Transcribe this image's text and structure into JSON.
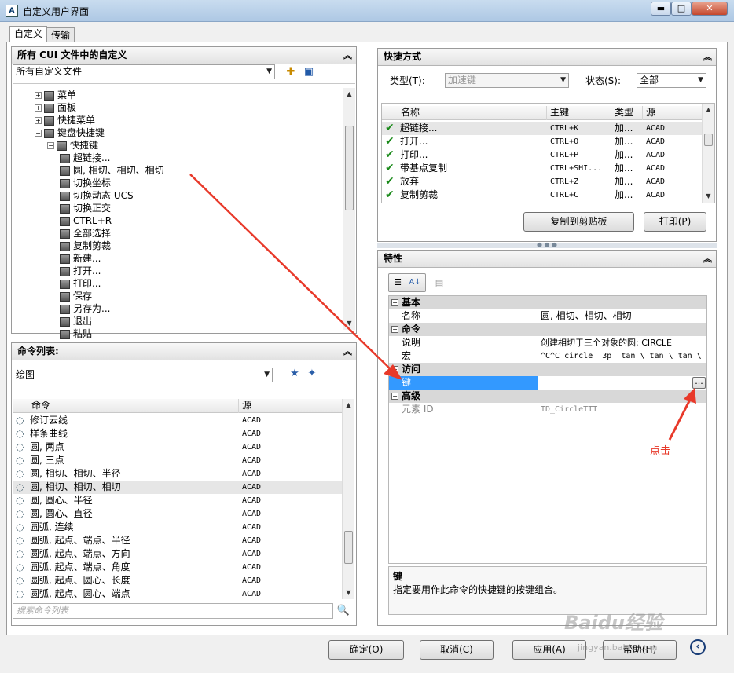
{
  "window": {
    "title": "自定义用户界面",
    "minimize": "▬",
    "maximize": "□",
    "close": "✕"
  },
  "tabs": [
    {
      "label": "自定义"
    },
    {
      "label": "传输"
    }
  ],
  "customizations_panel": {
    "title": "所有 CUI 文件中的自定义",
    "file_combo": "所有自定义文件",
    "tree": [
      {
        "label": "菜单",
        "icon": "menu-icon",
        "expander": "+"
      },
      {
        "label": "面板",
        "icon": "panel-icon",
        "expander": "+"
      },
      {
        "label": "快捷菜单",
        "icon": "shortcut-menu-icon",
        "expander": "+"
      },
      {
        "label": "键盘快捷键",
        "icon": "keyboard-icon",
        "expander": "−"
      },
      {
        "label": "快捷键",
        "icon": "keyboard-icon",
        "expander": "−"
      },
      {
        "label": "超链接..."
      },
      {
        "label": "圆, 相切、相切、相切"
      },
      {
        "label": "切换坐标"
      },
      {
        "label": "切换动态 UCS"
      },
      {
        "label": "切换正交"
      },
      {
        "label": "CTRL+R"
      },
      {
        "label": "全部选择"
      },
      {
        "label": "复制剪裁"
      },
      {
        "label": "新建..."
      },
      {
        "label": "打开..."
      },
      {
        "label": "打印..."
      },
      {
        "label": "保存"
      },
      {
        "label": "另存为..."
      },
      {
        "label": "退出"
      },
      {
        "label": "粘贴"
      }
    ]
  },
  "command_list": {
    "title": "命令列表:",
    "filter": "绘图",
    "columns": {
      "command": "命令",
      "source": "源"
    },
    "rows": [
      {
        "name": "修订云线",
        "source": "ACAD"
      },
      {
        "name": "样条曲线",
        "source": "ACAD"
      },
      {
        "name": "圆, 两点",
        "source": "ACAD"
      },
      {
        "name": "圆, 三点",
        "source": "ACAD"
      },
      {
        "name": "圆, 相切、相切、半径",
        "source": "ACAD"
      },
      {
        "name": "圆, 相切、相切、相切",
        "source": "ACAD"
      },
      {
        "name": "圆, 圆心、半径",
        "source": "ACAD"
      },
      {
        "name": "圆, 圆心、直径",
        "source": "ACAD"
      },
      {
        "name": "圆弧, 连续",
        "source": "ACAD"
      },
      {
        "name": "圆弧, 起点、端点、半径",
        "source": "ACAD"
      },
      {
        "name": "圆弧, 起点、端点、方向",
        "source": "ACAD"
      },
      {
        "name": "圆弧, 起点、端点、角度",
        "source": "ACAD"
      },
      {
        "name": "圆弧, 起点、圆心、长度",
        "source": "ACAD"
      },
      {
        "name": "圆弧, 起点、圆心、端点",
        "source": "ACAD"
      }
    ],
    "search_placeholder": "搜索命令列表"
  },
  "shortcuts_panel": {
    "title": "快捷方式",
    "type_label": "类型(T):",
    "type_value": "加速键",
    "status_label": "状态(S):",
    "status_value": "全部",
    "columns": {
      "name": "名称",
      "key": "主键",
      "type": "类型",
      "source": "源"
    },
    "rows": [
      {
        "name": "超链接...",
        "key": "CTRL+K",
        "type": "加...",
        "source": "ACAD"
      },
      {
        "name": "打开...",
        "key": "CTRL+O",
        "type": "加...",
        "source": "ACAD"
      },
      {
        "name": "打印...",
        "key": "CTRL+P",
        "type": "加...",
        "source": "ACAD"
      },
      {
        "name": "带基点复制",
        "key": "CTRL+SHI...",
        "type": "加...",
        "source": "ACAD"
      },
      {
        "name": "放弃",
        "key": "CTRL+Z",
        "type": "加...",
        "source": "ACAD"
      },
      {
        "name": "复制剪裁",
        "key": "CTRL+C",
        "type": "加...",
        "source": "ACAD"
      }
    ],
    "copy_button": "复制到剪贴板",
    "print_button": "打印(P)"
  },
  "properties_panel": {
    "title": "特性",
    "categories": {
      "basic": "基本",
      "command": "命令",
      "access": "访问",
      "advanced": "高级"
    },
    "props": {
      "name_label": "名称",
      "name_value": "圆, 相切、相切、相切",
      "desc_label": "说明",
      "desc_value": "创建相切于三个对象的圆: CIRCLE",
      "macro_label": "宏",
      "macro_value": "^C^C_circle _3p _tan \\_tan \\_tan \\",
      "key_label": "键",
      "key_value": "",
      "element_label": "元素 ID",
      "element_value": "ID_CircleTTT"
    },
    "browse_button": "...",
    "help_title": "键",
    "help_text": "指定要用作此命令的快捷键的按键组合。"
  },
  "annotation": {
    "click_label": "点击",
    "arrow_color": "#e8392a"
  },
  "footer": {
    "ok": "确定(O)",
    "cancel": "取消(C)",
    "apply": "应用(A)",
    "help": "帮助(H)"
  },
  "watermark": {
    "logo_text": "Baidu经验",
    "url": "jingyan.baidu.com"
  }
}
